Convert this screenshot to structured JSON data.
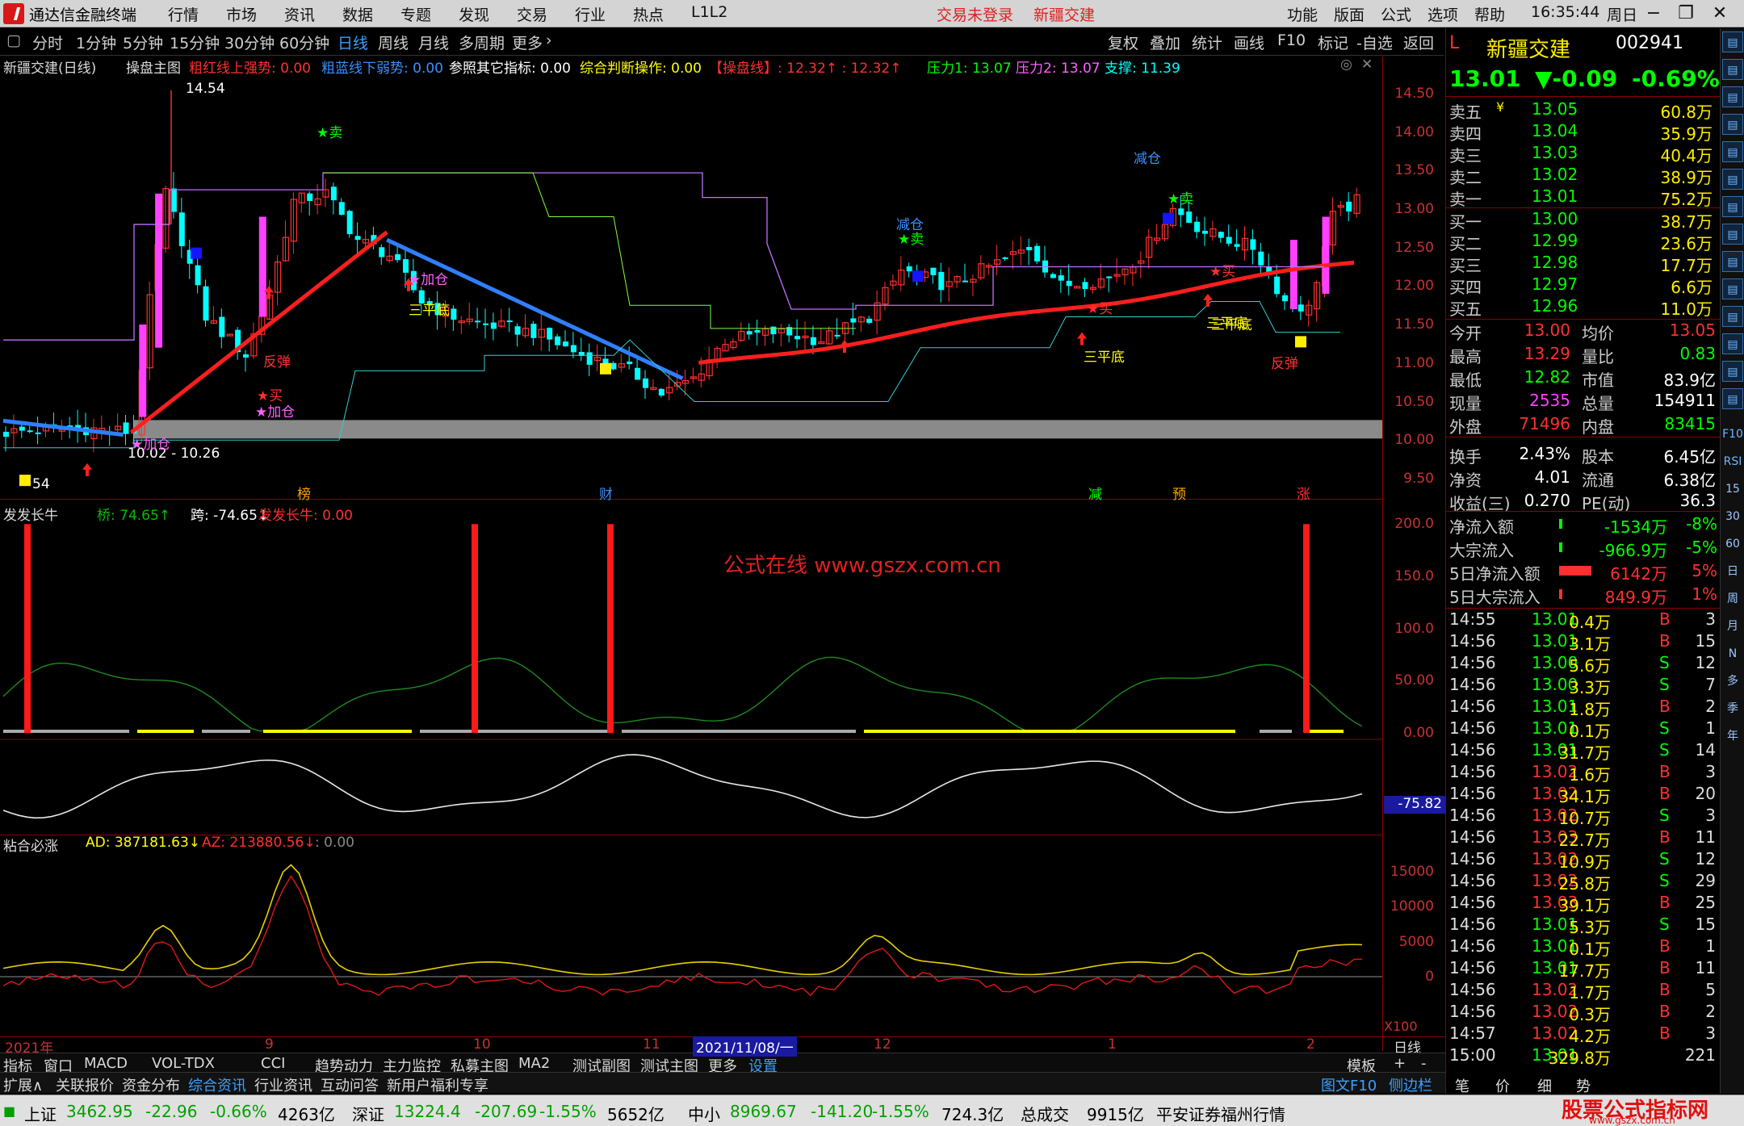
{
  "menubar": {
    "app": "通达信金融终端",
    "items": [
      "行情",
      "市场",
      "资讯",
      "数据",
      "专题",
      "发现",
      "交易",
      "行业",
      "热点",
      "L1L2"
    ],
    "trade_status": "交易未登录",
    "stock": "新疆交建",
    "right_items": [
      "功能",
      "版面",
      "公式",
      "选项",
      "帮助"
    ],
    "time": "16:35:44",
    "weekday": "周日"
  },
  "toolbar": {
    "periods": [
      "分时",
      "1分钟",
      "5分钟",
      "15分钟",
      "30分钟",
      "60分钟",
      "日线",
      "周线",
      "月线",
      "多周期",
      "更多"
    ],
    "active_period": "日线",
    "right": [
      "复权",
      "叠加",
      "统计",
      "画线",
      "F10",
      "标记",
      "-自选",
      "返回"
    ]
  },
  "main_header": {
    "title": "新疆交建(日线)",
    "indicator": "操盘主图",
    "items": [
      {
        "t": "粗红线上强势: 0.00",
        "c": "#ff3030"
      },
      {
        "t": "粗蓝线下弱势: 0.00",
        "c": "#3a90ff"
      },
      {
        "t": "参照其它指标: 0.00",
        "c": "#ffffff"
      },
      {
        "t": "综合判断操作: 0.00",
        "c": "#ffff00"
      },
      {
        "t": "【操盘线】: 12.32↑ : 12.32↑",
        "c": "#ff3030"
      },
      {
        "t": "压力1: 13.07",
        "c": "#00ff00"
      },
      {
        "t": "压力2: 13.07",
        "c": "#ff60ff"
      },
      {
        "t": "支撑: 11.39",
        "c": "#00ffff"
      }
    ]
  },
  "main_axis": [
    "14.50",
    "14.00",
    "13.50",
    "13.00",
    "12.50",
    "12.00",
    "11.50",
    "11.00",
    "10.50",
    "10.00",
    "9.50"
  ],
  "main_annotations": [
    {
      "t": "14.54",
      "c": "#ffffff"
    },
    {
      "t": "10.02 - 10.26",
      "c": "#ffffff"
    },
    {
      "t": "54",
      "c": "#ffffff"
    },
    {
      "t": "反弹",
      "c": "#ff3030"
    },
    {
      "t": "★买",
      "c": "#ff3030"
    },
    {
      "t": "★加仓",
      "c": "#ff60ff"
    },
    {
      "t": "★加仓",
      "c": "#ff60ff"
    },
    {
      "t": "★卖",
      "c": "#00ff00"
    },
    {
      "t": "★加仓",
      "c": "#ff60ff"
    },
    {
      "t": "三平底",
      "c": "#ffff00"
    },
    {
      "t": "减仓",
      "c": "#3a90ff"
    },
    {
      "t": "★卖",
      "c": "#00ff00"
    },
    {
      "t": "减仓",
      "c": "#3a90ff"
    },
    {
      "t": "★卖",
      "c": "#00ff00"
    },
    {
      "t": "★买",
      "c": "#ff3030"
    },
    {
      "t": "三平底",
      "c": "#ffff00"
    },
    {
      "t": "★买",
      "c": "#ff3030"
    },
    {
      "t": "三平底",
      "c": "#ffff00"
    },
    {
      "t": "反弹",
      "c": "#ff3030"
    },
    {
      "t": "三平底",
      "c": "#ffff00"
    }
  ],
  "event_markers": [
    {
      "t": "榜",
      "c": "#ffa500"
    },
    {
      "t": "财",
      "c": "#3a90ff"
    },
    {
      "t": "减",
      "c": "#00ff00"
    },
    {
      "t": "预",
      "c": "#ffa500"
    },
    {
      "t": "涨",
      "c": "#ff3030"
    }
  ],
  "panel2": {
    "name": "发发长牛",
    "items": [
      {
        "t": "桥: 74.65↑",
        "c": "#00c000"
      },
      {
        "t": "跨: -74.65↓",
        "c": "#ffffff"
      },
      {
        "t": "发发长牛: 0.00",
        "c": "#ff3030"
      }
    ],
    "axis": [
      "200.0",
      "150.0",
      "100.0",
      "50.00",
      "0.00"
    ],
    "watermark": "公式在线  www.gszx.com.cn",
    "value_tag": "-75.82"
  },
  "panel3": {
    "name": "粘合必涨",
    "items": [
      {
        "t": "AD: 387181.63↓",
        "c": "#ffff00"
      },
      {
        "t": "AZ: 213880.56↓",
        "c": "#ff3030"
      },
      {
        "t": ": 0.00",
        "c": "#888888"
      }
    ],
    "axis": [
      "15000",
      "10000",
      "5000",
      "0"
    ],
    "scale": "X100"
  },
  "date_axis": [
    "2021年",
    "9",
    "10",
    "11",
    "2021/11/08/一",
    "12",
    "1",
    "2"
  ],
  "date_mode": "日线",
  "quote": {
    "market_prefix": "L",
    "name": "新疆交建",
    "code": "002941",
    "price": "13.01",
    "change": "▼-0.09",
    "pct": "-0.69%",
    "asks": [
      {
        "l": "卖五",
        "p": "13.05",
        "v": "60.8万",
        "flag": "¥"
      },
      {
        "l": "卖四",
        "p": "13.04",
        "v": "35.9万"
      },
      {
        "l": "卖三",
        "p": "13.03",
        "v": "40.4万"
      },
      {
        "l": "卖二",
        "p": "13.02",
        "v": "38.9万"
      },
      {
        "l": "卖一",
        "p": "13.01",
        "v": "75.2万"
      }
    ],
    "bids": [
      {
        "l": "买一",
        "p": "13.00",
        "v": "38.7万"
      },
      {
        "l": "买二",
        "p": "12.99",
        "v": "23.6万"
      },
      {
        "l": "买三",
        "p": "12.98",
        "v": "17.7万"
      },
      {
        "l": "买四",
        "p": "12.97",
        "v": "6.6万"
      },
      {
        "l": "买五",
        "p": "12.96",
        "v": "11.0万"
      }
    ],
    "stats": [
      {
        "a": "今开",
        "av": "13.00",
        "ac": "#ff3030",
        "b": "均价",
        "bv": "13.05",
        "bc": "#ff3030"
      },
      {
        "a": "最高",
        "av": "13.29",
        "ac": "#ff3030",
        "b": "量比",
        "bv": "0.83",
        "bc": "#00ff00"
      },
      {
        "a": "最低",
        "av": "12.82",
        "ac": "#00ff00",
        "b": "市值",
        "bv": "83.9亿",
        "bc": "#ffffff"
      },
      {
        "a": "现量",
        "av": "2535",
        "ac": "#ff40ff",
        "b": "总量",
        "bv": "154911",
        "bc": "#ffffff"
      },
      {
        "a": "外盘",
        "av": "71496",
        "ac": "#ff3030",
        "b": "内盘",
        "bv": "83415",
        "bc": "#00ff00"
      },
      {
        "a": "换手",
        "av": "2.43%",
        "ac": "#ffffff",
        "b": "股本",
        "bv": "6.45亿",
        "bc": "#ffffff"
      },
      {
        "a": "净资",
        "av": "4.01",
        "ac": "#ffffff",
        "b": "流通",
        "bv": "6.38亿",
        "bc": "#ffffff"
      },
      {
        "a": "收益(三)",
        "av": "0.270",
        "ac": "#ffffff",
        "b": "PE(动)",
        "bv": "36.3",
        "bc": "#ffffff"
      }
    ],
    "flows": [
      {
        "l": "净流入额",
        "v": "-1534万",
        "p": "-8%",
        "c": "#00ff00",
        "bar": 0.02
      },
      {
        "l": "大宗流入",
        "v": "-966.9万",
        "p": "-5%",
        "c": "#00ff00",
        "bar": 0.01
      },
      {
        "l": "5日净流入额",
        "v": "6142万",
        "p": "5%",
        "c": "#ff3030",
        "bar": 0.5
      },
      {
        "l": "5日大宗流入",
        "v": "849.9万",
        "p": "1%",
        "c": "#ff3030",
        "bar": 0.0
      }
    ],
    "ticks": [
      {
        "t": "14:55",
        "p": "13.01",
        "v": "0.4万",
        "bs": "B",
        "n": "3"
      },
      {
        "t": "14:56",
        "p": "13.01",
        "v": "3.1万",
        "bs": "B",
        "n": "15"
      },
      {
        "t": "14:56",
        "p": "13.00",
        "v": "5.6万",
        "bs": "S",
        "n": "12"
      },
      {
        "t": "14:56",
        "p": "13.00",
        "v": "3.3万",
        "bs": "S",
        "n": "7"
      },
      {
        "t": "14:56",
        "p": "13.01",
        "v": "1.8万",
        "bs": "B",
        "n": "2"
      },
      {
        "t": "14:56",
        "p": "13.01",
        "v": "0.1万",
        "bs": "S",
        "n": "1"
      },
      {
        "t": "14:56",
        "p": "13.01",
        "v": "31.7万",
        "bs": "S",
        "n": "14"
      },
      {
        "t": "14:56",
        "p": "13.02",
        "v": "1.6万",
        "bs": "B",
        "n": "3"
      },
      {
        "t": "14:56",
        "p": "13.02",
        "v": "34.1万",
        "bs": "B",
        "n": "20"
      },
      {
        "t": "14:56",
        "p": "13.02",
        "v": "10.7万",
        "bs": "S",
        "n": "3"
      },
      {
        "t": "14:56",
        "p": "13.03",
        "v": "22.7万",
        "bs": "B",
        "n": "11"
      },
      {
        "t": "14:56",
        "p": "13.02",
        "v": "10.9万",
        "bs": "S",
        "n": "12"
      },
      {
        "t": "14:56",
        "p": "13.02",
        "v": "25.8万",
        "bs": "S",
        "n": "29"
      },
      {
        "t": "14:56",
        "p": "13.03",
        "v": "39.1万",
        "bs": "B",
        "n": "25"
      },
      {
        "t": "14:56",
        "p": "13.01",
        "v": "5.3万",
        "bs": "S",
        "n": "15"
      },
      {
        "t": "14:56",
        "p": "13.01",
        "v": "0.1万",
        "bs": "B",
        "n": "1"
      },
      {
        "t": "14:56",
        "p": "13.01",
        "v": "17.7万",
        "bs": "B",
        "n": "11"
      },
      {
        "t": "14:56",
        "p": "13.02",
        "v": "1.7万",
        "bs": "B",
        "n": "5"
      },
      {
        "t": "14:56",
        "p": "13.02",
        "v": "0.3万",
        "bs": "B",
        "n": "2"
      },
      {
        "t": "14:57",
        "p": "13.02",
        "v": "4.2万",
        "bs": "B",
        "n": "3"
      },
      {
        "t": "15:00",
        "p": "13.01",
        "v": "329.8万",
        "bs": "",
        "n": "221"
      }
    ]
  },
  "sidebar_icons": [
    "F10",
    "RSI",
    "15",
    "30",
    "60",
    "日",
    "周",
    "月",
    "N",
    "多",
    "季",
    "年"
  ],
  "tabs_row1": [
    "指标",
    "窗口",
    "MACD",
    "VOL-TDX",
    "CCI",
    "趋势动力",
    "主力监控",
    "私募主图",
    "MA2",
    "测试副图",
    "测试主图",
    "更多",
    "设置"
  ],
  "tabs_row1_right": [
    "模板",
    "+",
    "-"
  ],
  "tabs_row2": [
    "扩展∧",
    "关联报价",
    "资金分布",
    "综合资讯",
    "行业资讯",
    "互动问答",
    "新用户福利专享"
  ],
  "tabs_row2_right": [
    "图文F10",
    "侧边栏《",
    "笔",
    "价",
    "细",
    "势"
  ],
  "status": {
    "sh": {
      "name": "上证",
      "v": "3462.95",
      "c": "-22.96",
      "p": "-0.66%",
      "amt": "4263亿"
    },
    "sz": {
      "name": "深证",
      "v": "13224.4",
      "c": "-207.69",
      "p": "-1.55%",
      "amt": "5652亿"
    },
    "zx": {
      "name": "中小",
      "v": "8969.67",
      "c": "-141.20",
      "p": "-1.55%",
      "amt": "724.3亿"
    },
    "total_label": "总成交",
    "total": "9915亿",
    "broker": "平安证券福州行情",
    "brand": "股票公式指标网",
    "brand_url": "www.gszx.com.cn"
  }
}
